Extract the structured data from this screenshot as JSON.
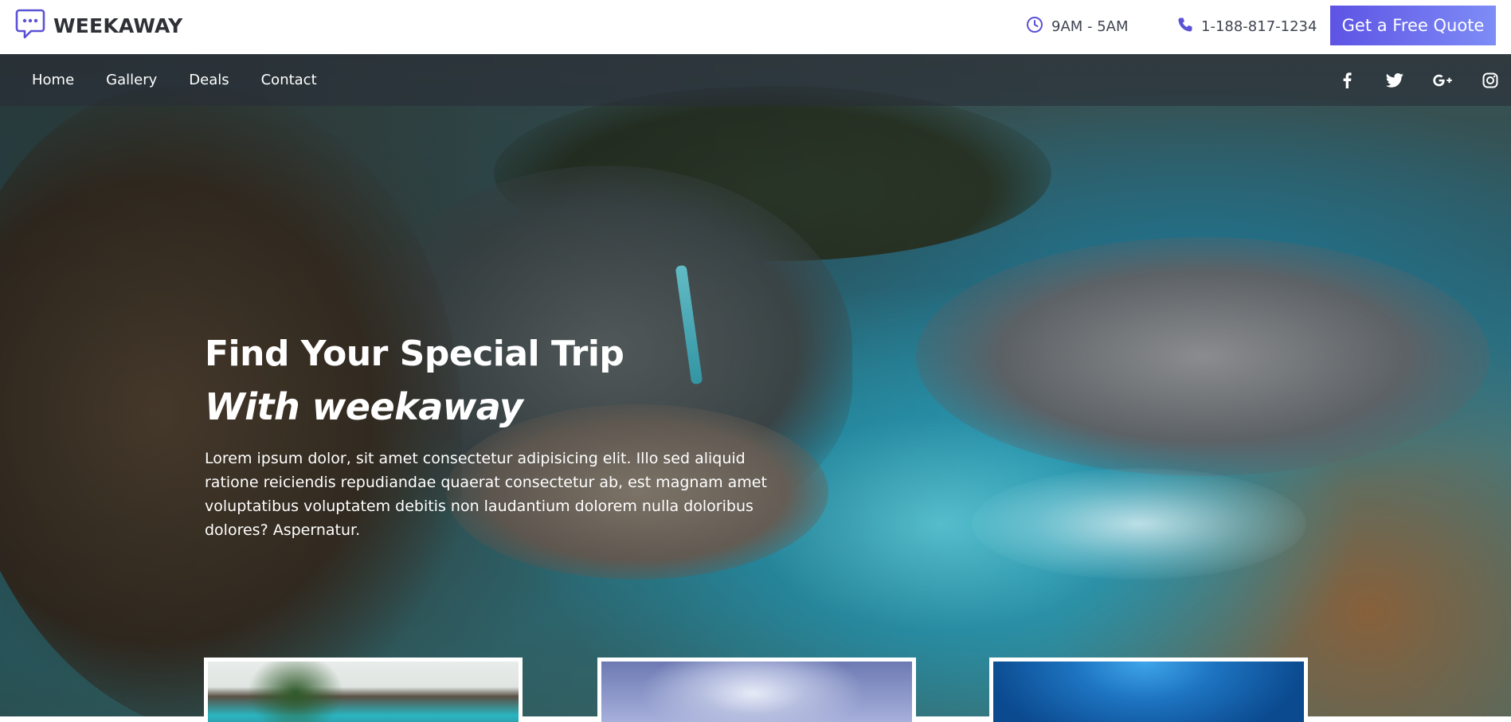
{
  "brand": {
    "name": "WEEKAWAY",
    "logo_icon": "chat-bubble-icon"
  },
  "header": {
    "hours": {
      "icon": "clock-icon",
      "text": "9AM - 5AM"
    },
    "phone": {
      "icon": "phone-icon",
      "text": "1-188-817-1234"
    },
    "cta_label": "Get a Free Quote"
  },
  "nav": {
    "items": [
      {
        "label": "Home"
      },
      {
        "label": "Gallery"
      },
      {
        "label": "Deals"
      },
      {
        "label": "Contact"
      }
    ],
    "socials": [
      "facebook-icon",
      "twitter-icon",
      "google-plus-icon",
      "instagram-icon"
    ]
  },
  "hero": {
    "title": "Find Your Special Trip",
    "subtitle": "With weekaway",
    "body": "Lorem ipsum dolor, sit amet consectetur adipisicing elit. Illo sed aliquid ratione reiciendis repudiandae quaerat consectetur ab, est magnam amet voluptatibus voluptatem debitis non laudantium dolorem nulla doloribus dolores? Aspernatur."
  },
  "colors": {
    "accent_start": "#5d53e4",
    "accent_end": "#7e8df6",
    "icon_accent": "#5b52d6",
    "brand_text": "#2f3137"
  }
}
